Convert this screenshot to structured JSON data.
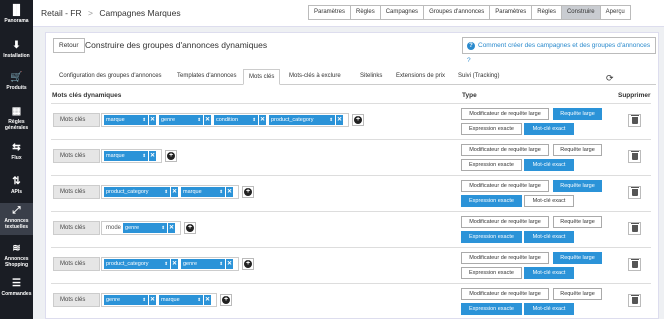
{
  "sidebar": {
    "items": [
      {
        "icon": "bars-icon",
        "glyph": "▐▌",
        "label": "Panorama"
      },
      {
        "icon": "download-icon",
        "glyph": "⬇",
        "label": "Installation"
      },
      {
        "icon": "cart-icon",
        "glyph": "🛒",
        "label": "Produits"
      },
      {
        "icon": "rules-icon",
        "glyph": "▦",
        "label": "Règles générales"
      },
      {
        "icon": "flow-icon",
        "glyph": "⇆",
        "label": "Flux"
      },
      {
        "icon": "api-icon",
        "glyph": "⇅",
        "label": "APIs"
      },
      {
        "icon": "expand-icon",
        "glyph": "⤢",
        "label": "Annonces textuelles"
      },
      {
        "icon": "layers-icon",
        "glyph": "≋",
        "label": "Annonces Shopping"
      },
      {
        "icon": "orders-icon",
        "glyph": "☰",
        "label": "Commandes"
      }
    ]
  },
  "header": {
    "breadcrumb": [
      "Retail - FR",
      ">",
      "Campagnes Marques"
    ],
    "steps": [
      "Paramètres",
      "Règles",
      "Campagnes",
      "Groupes d'annonces",
      "Paramètres",
      "Règles",
      "Construire",
      "Aperçu"
    ],
    "active_step": 6
  },
  "page": {
    "back_label": "Retour",
    "title": "Construire des groupes d'annonces dynamiques",
    "help_label": "Comment créer des campagnes et des groupes d'annonces ?",
    "help_icon_glyph": "?"
  },
  "tabs": [
    "Configuration des groupes d'annonces",
    "Templates d'annonces",
    "Mots clés",
    "Mots-clés à exclure",
    "Sitelinks",
    "Extensions de prix",
    "Suivi (Tracking)"
  ],
  "active_tab": 2,
  "refresh_glyph": "⟳",
  "table": {
    "col_keywords": "Mots clés dynamiques",
    "col_type": "Type",
    "col_delete": "Supprimer",
    "row_label": "Mots clés",
    "type_labels": {
      "mod_broad": "Modificateur de requête large",
      "broad": "Requête large",
      "phrase": "Expression exacte",
      "exact": "Mot-clé exact"
    },
    "rows": [
      {
        "prefix": "",
        "chips": [
          "marque",
          "genre",
          "condition",
          "product_category"
        ],
        "active": {
          "mod_broad": false,
          "broad": true,
          "phrase": false,
          "exact": true
        }
      },
      {
        "prefix": "",
        "chips": [
          "marque"
        ],
        "active": {
          "mod_broad": false,
          "broad": false,
          "phrase": false,
          "exact": true
        }
      },
      {
        "prefix": "",
        "chips": [
          "product_category",
          "marque"
        ],
        "active": {
          "mod_broad": false,
          "broad": true,
          "phrase": true,
          "exact": false
        }
      },
      {
        "prefix": "mode",
        "chips": [
          "genre"
        ],
        "active": {
          "mod_broad": false,
          "broad": false,
          "phrase": true,
          "exact": true
        }
      },
      {
        "prefix": "",
        "chips": [
          "product_category",
          "genre"
        ],
        "active": {
          "mod_broad": false,
          "broad": true,
          "phrase": false,
          "exact": true
        }
      },
      {
        "prefix": "",
        "chips": [
          "genre",
          "marque"
        ],
        "active": {
          "mod_broad": false,
          "broad": false,
          "phrase": true,
          "exact": true
        }
      }
    ]
  },
  "colors": {
    "accent": "#2b93d8",
    "sidebar": "#1a1d24"
  }
}
